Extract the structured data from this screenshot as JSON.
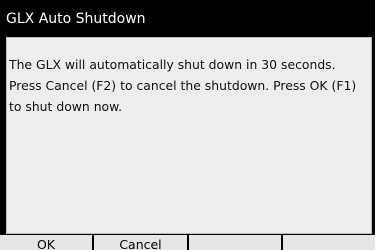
{
  "window": {
    "title": "GLX Auto Shutdown"
  },
  "dialog": {
    "message_lines": [
      "The GLX will automatically shut down in 30 seconds.",
      "Press Cancel (F2) to cancel the shutdown. Press OK (F1)",
      "to shut down now."
    ]
  },
  "softkeys": [
    {
      "label": "OK"
    },
    {
      "label": "Cancel"
    },
    {
      "label": ""
    },
    {
      "label": ""
    }
  ],
  "colors": {
    "titlebar_bg": "#000000",
    "titlebar_text": "#ffffff",
    "dialog_bg": "#ededed",
    "softkey_bg": "#e6e6e6"
  }
}
